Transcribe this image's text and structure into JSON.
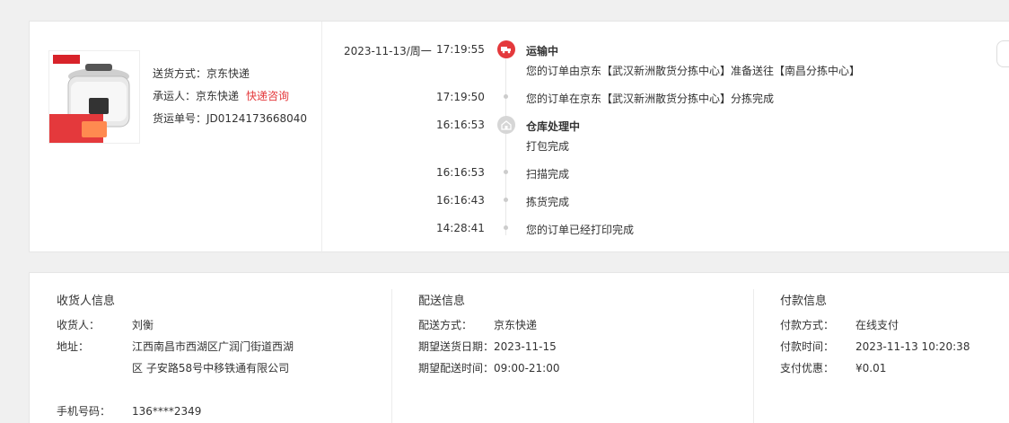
{
  "shipment": {
    "method_label": "送货方式：",
    "method_value": "京东快递",
    "carrier_label": "承运人：",
    "carrier_value": "京东快递",
    "carrier_link": "快递咨询",
    "tracking_label": "货运单号：",
    "tracking_value": "JD0124173668040"
  },
  "timeline": {
    "date": "2023-11-13/周一",
    "events": [
      {
        "time": "17:19:55",
        "title": "运输中",
        "text": "您的订单由京东【武汉新洲散货分拣中心】准备送往【南昌分拣中心】"
      },
      {
        "time": "17:19:50",
        "title": "",
        "text": "您的订单在京东【武汉新洲散货分拣中心】分拣完成"
      },
      {
        "time": "16:16:53",
        "title": "仓库处理中",
        "text": "打包完成"
      },
      {
        "time": "16:16:53",
        "title": "",
        "text": "扫描完成"
      },
      {
        "time": "16:16:43",
        "title": "",
        "text": "拣货完成"
      },
      {
        "time": "14:28:41",
        "title": "",
        "text": "您的订单已经打印完成"
      }
    ]
  },
  "receiver": {
    "title": "收货人信息",
    "name_label": "收货人：",
    "name_value": "刘衡",
    "address_label": "地址：",
    "address_value": "江西南昌市西湖区广润门街道西湖区 子安路58号中移铁通有限公司",
    "phone_label": "手机号码：",
    "phone_value": "136****2349"
  },
  "delivery": {
    "title": "配送信息",
    "method_label": "配送方式：",
    "method_value": "京东快递",
    "date_label": "期望送货日期：",
    "date_value": "2023-11-15",
    "time_label": "期望配送时间：",
    "time_value": "09:00-21:00"
  },
  "payment": {
    "title": "付款信息",
    "method_label": "付款方式：",
    "method_value": "在线支付",
    "time_label": "付款时间：",
    "time_value": "2023-11-13 10:20:38",
    "discount_label": "支付优惠：",
    "discount_value": "¥0.01"
  }
}
